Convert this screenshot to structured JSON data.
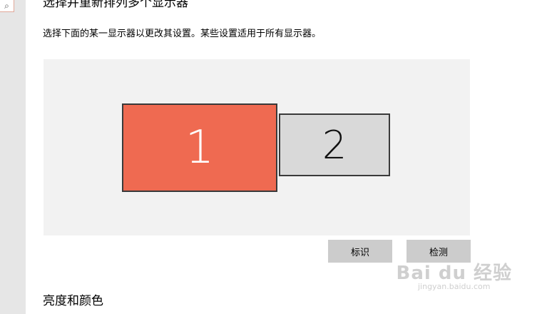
{
  "search": {
    "icon": "search-icon",
    "glyph": "⌕"
  },
  "page": {
    "title": "选择并重新排列多个显示器",
    "subtitle": "选择下面的某一显示器以更改其设置。某些设置适用于所有显示器。"
  },
  "displays": [
    {
      "label": "1",
      "selected": true,
      "color": "#ef6a51"
    },
    {
      "label": "2",
      "selected": false,
      "color": "#d9d9d9"
    }
  ],
  "buttons": {
    "identify": "标识",
    "detect": "检测"
  },
  "sections": {
    "brightness_color": "亮度和颜色"
  },
  "watermark": {
    "brand": "Bai du 经验",
    "url": "jingyan.baidu.com"
  }
}
